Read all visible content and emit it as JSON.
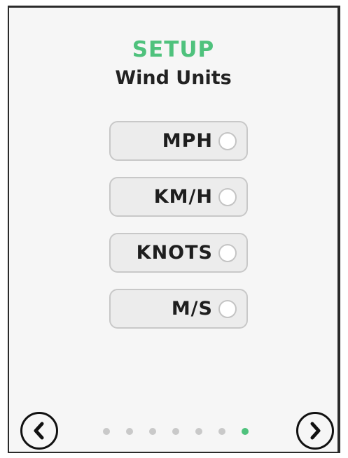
{
  "header": {
    "section_label": "SETUP",
    "screen_title": "Wind Units"
  },
  "options": [
    {
      "label": "MPH",
      "selected": false
    },
    {
      "label": "KM/H",
      "selected": false
    },
    {
      "label": "KNOTS",
      "selected": false
    },
    {
      "label": "M/S",
      "selected": false
    }
  ],
  "navigation": {
    "prev_icon": "chevron-left-icon",
    "next_icon": "chevron-right-icon",
    "page_count": 7,
    "current_page": 7
  },
  "colors": {
    "accent": "#4fc27d",
    "dot_inactive": "#c9c9c9",
    "background": "#f6f6f6"
  }
}
